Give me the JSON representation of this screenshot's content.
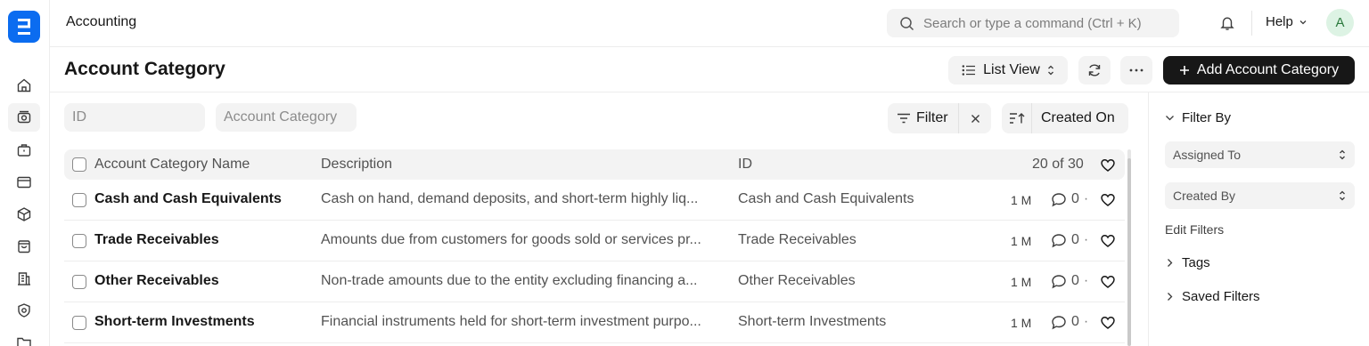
{
  "app": {
    "title": "Accounting",
    "logo_letter": "E"
  },
  "search": {
    "placeholder": "Search or type a command (Ctrl + K)"
  },
  "topbar": {
    "help_label": "Help",
    "avatar_initial": "A"
  },
  "rail": {
    "icons": [
      "home-icon",
      "accounting-icon",
      "briefcase-icon",
      "card-icon",
      "box-icon",
      "bag-icon",
      "building-icon",
      "shield-icon",
      "folder-icon"
    ]
  },
  "page": {
    "title": "Account Category",
    "list_view_label": "List View",
    "add_button_label": "Add Account Category"
  },
  "filters": {
    "id_placeholder": "ID",
    "category_placeholder": "Account Category",
    "filter_label": "Filter",
    "sort_label": "Created On"
  },
  "table": {
    "columns": {
      "name": "Account Category Name",
      "description": "Description",
      "id": "ID"
    },
    "count": "20 of 30",
    "rows": [
      {
        "name": "Cash and Cash Equivalents",
        "description": "Cash on hand, demand deposits, and short-term highly liq...",
        "id": "Cash and Cash Equivalents",
        "time": "1 M",
        "comments": "0"
      },
      {
        "name": "Trade Receivables",
        "description": "Amounts due from customers for goods sold or services pr...",
        "id": "Trade Receivables",
        "time": "1 M",
        "comments": "0"
      },
      {
        "name": "Other Receivables",
        "description": "Non-trade amounts due to the entity excluding financing a...",
        "id": "Other Receivables",
        "time": "1 M",
        "comments": "0"
      },
      {
        "name": "Short-term Investments",
        "description": "Financial instruments held for short-term investment purpo...",
        "id": "Short-term Investments",
        "time": "1 M",
        "comments": "0"
      }
    ]
  },
  "sidebar": {
    "filter_by_label": "Filter By",
    "assigned_to_label": "Assigned To",
    "created_by_label": "Created By",
    "edit_filters_label": "Edit Filters",
    "tags_label": "Tags",
    "saved_filters_label": "Saved Filters"
  },
  "colors": {
    "logo_blue": "#0b6cf0",
    "primary_button": "#171717",
    "avatar_bg": "#ddf3e4"
  }
}
